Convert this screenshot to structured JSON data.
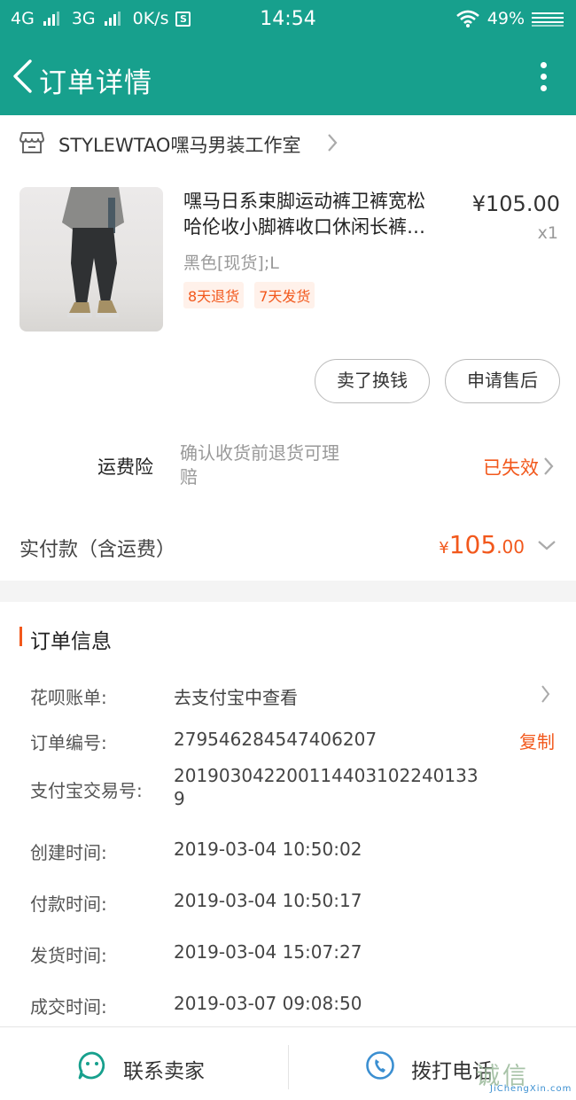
{
  "status_bar": {
    "net1": "4G",
    "net2": "3G",
    "speed": "0K/s",
    "sim_badge": "S",
    "time": "14:54",
    "battery": "49%"
  },
  "header": {
    "title": "订单详情"
  },
  "shop": {
    "name": "STYLEWTAO嘿马男装工作室"
  },
  "product": {
    "title_line1": "嘿马日系束脚运动裤卫裤宽松",
    "title_line2": "哈伦收小脚裤收口休闲长裤…",
    "price": "¥105.00",
    "qty": "x1",
    "sku": "黑色[现货];L",
    "tags": [
      "8天退货",
      "7天发货"
    ]
  },
  "actions": {
    "sell": "卖了换钱",
    "after_sale": "申请售后"
  },
  "freight": {
    "label": "运费险",
    "desc_line1": "确认收货前退货可理",
    "desc_line2": "赔",
    "status": "已失效"
  },
  "total": {
    "label": "实付款（含运费）",
    "currency": "¥",
    "integer": "105",
    "decimal": ".00"
  },
  "order_info": {
    "title": "订单信息",
    "huabei_label": "花呗账单:",
    "huabei_value": "去支付宝中查看",
    "order_no_label": "订单编号:",
    "order_no_value": "279546284547406207",
    "copy": "复制",
    "alipay_label": "支付宝交易号:",
    "alipay_value": "2019030422001144031022401339",
    "created_label": "创建时间:",
    "created_value": "2019-03-04 10:50:02",
    "paid_label": "付款时间:",
    "paid_value": "2019-03-04 10:50:17",
    "shipped_label": "发货时间:",
    "shipped_value": "2019-03-04 15:07:27",
    "done_label": "成交时间:",
    "done_value": "2019-03-07 09:08:50"
  },
  "bottom": {
    "contact": "联系卖家",
    "call": "拨打电话"
  },
  "watermark": {
    "main": "诚信",
    "sub": "JiChengXin.com"
  },
  "colors": {
    "brand": "#17a08d",
    "accent": "#f2581c",
    "call_icon": "#3b8fd1"
  }
}
